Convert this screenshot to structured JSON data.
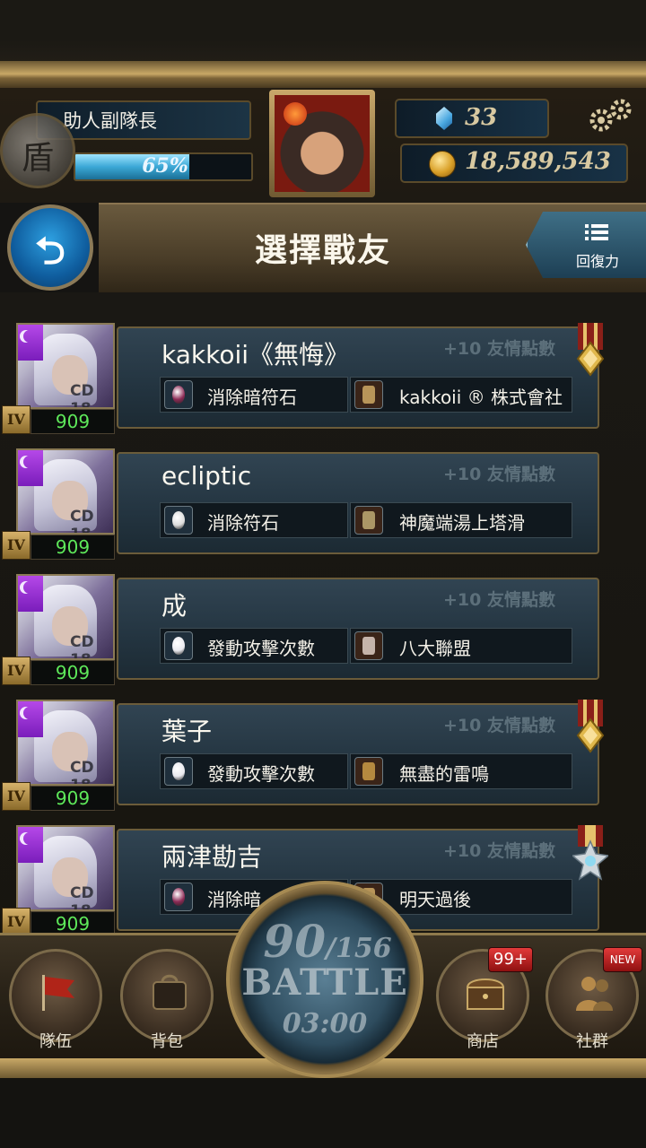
{
  "header": {
    "player_title": "助人副隊長",
    "rank_glyph": "盾",
    "exp_percent": 65,
    "exp_label": "65%",
    "gems": "33",
    "coins": "18,589,543"
  },
  "page": {
    "title": "選擇戰友",
    "back_icon": "⮌",
    "recover_label": "回復力"
  },
  "friend_points_label": "+10 友情點數",
  "friends": [
    {
      "name": "kakkoii《無悔》",
      "rank": "IV",
      "level": "909",
      "cd": "CD 18",
      "skill": "消除暗符石",
      "guild": "kakkoii ® 株式會社",
      "skill_gem": "#8c2a55",
      "guild_icon": "emblem",
      "medal": "gold"
    },
    {
      "name": "ecliptic",
      "rank": "IV",
      "level": "909",
      "cd": "CD 18",
      "skill": "消除符石",
      "guild": "神魔端湯上塔滑",
      "skill_gem": "#dcdcdc",
      "guild_icon": "eye-triangle",
      "medal": "none"
    },
    {
      "name": "成",
      "rank": "IV",
      "level": "909",
      "cd": "CD 18",
      "skill": "發動攻擊次數",
      "guild": "八大聯盟",
      "skill_gem": "#e9e9ef",
      "guild_icon": "rose",
      "medal": "none"
    },
    {
      "name": "葉子",
      "rank": "IV",
      "level": "909",
      "cd": "CD 18",
      "skill": "發動攻擊次數",
      "guild": "無盡的雷鳴",
      "skill_gem": "#e9e9ef",
      "guild_icon": "blades",
      "medal": "gold"
    },
    {
      "name": "兩津勘吉",
      "rank": "IV",
      "level": "909",
      "cd": "CD 18",
      "skill": "消除暗",
      "guild": "明天過後",
      "skill_gem": "#8c2a55",
      "guild_icon": "emblem",
      "medal": "silver-star"
    }
  ],
  "nav": {
    "team": "隊伍",
    "bag": "背包",
    "shop": "商店",
    "social": "社群",
    "shop_badge": "99+",
    "social_badge": "NEW"
  },
  "battle": {
    "stamina_current": "90",
    "stamina_max": "/156",
    "label": "BATTLE",
    "timer": "03:00"
  },
  "colors": {
    "accent_blue": "#2d9fe0",
    "level_green": "#5ee85a",
    "gold": "#c8a866"
  }
}
